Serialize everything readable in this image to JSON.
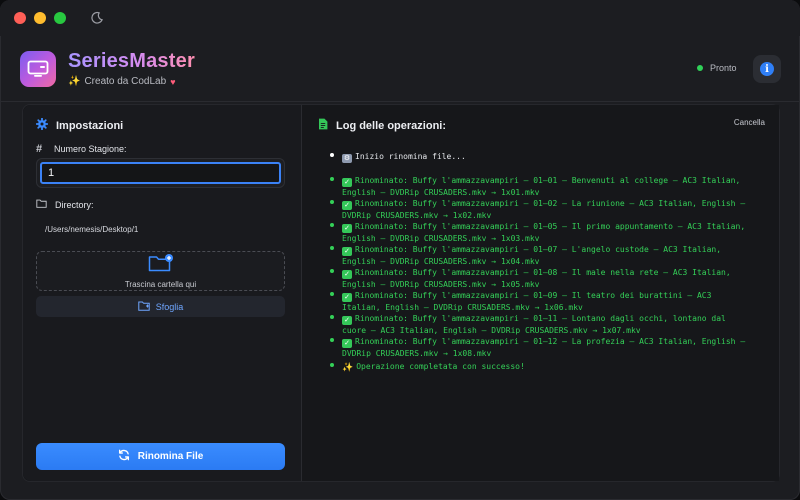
{
  "window": {
    "app_name": "SeriesMaster",
    "credit": "Creato da CodLab",
    "status": "Pronto",
    "info_icon": "i"
  },
  "settings": {
    "title": "Impostazioni",
    "season_label": "Numero Stagione:",
    "season_value": "1",
    "directory_label": "Directory:",
    "directory_path": "/Users/nemesis/Desktop/1",
    "dropzone_label": "Trascina cartella qui",
    "browse_label": "Sfoglia",
    "rename_label": "Rinomina File"
  },
  "log": {
    "title": "Log delle operazioni:",
    "cancel_label": "Cancella",
    "entries": [
      {
        "kind": "info",
        "icon": "gear",
        "text": "Inizio rinomina file..."
      },
      {
        "kind": "ok",
        "icon": "check",
        "text": "Rinominato: Buffy l'ammazzavampiri – 01–01 – Benvenuti al college – AC3 Italian, English – DVDRip CRUSADERS.mkv → 1x01.mkv"
      },
      {
        "kind": "ok",
        "icon": "check",
        "text": "Rinominato: Buffy l'ammazzavampiri – 01–02 – La riunione – AC3 Italian, English – DVDRip CRUSADERS.mkv → 1x02.mkv"
      },
      {
        "kind": "ok",
        "icon": "check",
        "text": "Rinominato: Buffy l'ammazzavampiri – 01–05 – Il primo appuntamento – AC3 Italian, English – DVDRip CRUSADERS.mkv → 1x03.mkv"
      },
      {
        "kind": "ok",
        "icon": "check",
        "text": "Rinominato: Buffy l'ammazzavampiri – 01–07 – L'angelo custode – AC3 Italian, English – DVDRip CRUSADERS.mkv → 1x04.mkv"
      },
      {
        "kind": "ok",
        "icon": "check",
        "text": "Rinominato: Buffy l'ammazzavampiri – 01–08 – Il male nella rete – AC3 Italian, English – DVDRip CRUSADERS.mkv → 1x05.mkv"
      },
      {
        "kind": "ok",
        "icon": "check",
        "text": "Rinominato: Buffy l'ammazzavampiri – 01–09 – Il teatro dei burattini – AC3 Italian, English – DVDRip CRUSADERS.mkv → 1x06.mkv"
      },
      {
        "kind": "ok",
        "icon": "check",
        "text": "Rinominato: Buffy l'ammazzavampiri – 01–11 – Lontano dagli occhi, lontano dal cuore – AC3 Italian, English – DVDRip CRUSADERS.mkv → 1x07.mkv"
      },
      {
        "kind": "ok",
        "icon": "check",
        "text": "Rinominato: Buffy l'ammazzavampiri – 01–12 – La profezia – AC3 Italian, English – DVDRip CRUSADERS.mkv → 1x08.mkv"
      },
      {
        "kind": "ok",
        "icon": "sparkles",
        "text": "Operazione completata con successo!"
      }
    ]
  },
  "colors": {
    "accent": "#2f7ff7",
    "log_green": "#34d058",
    "status_green": "#30d158"
  }
}
